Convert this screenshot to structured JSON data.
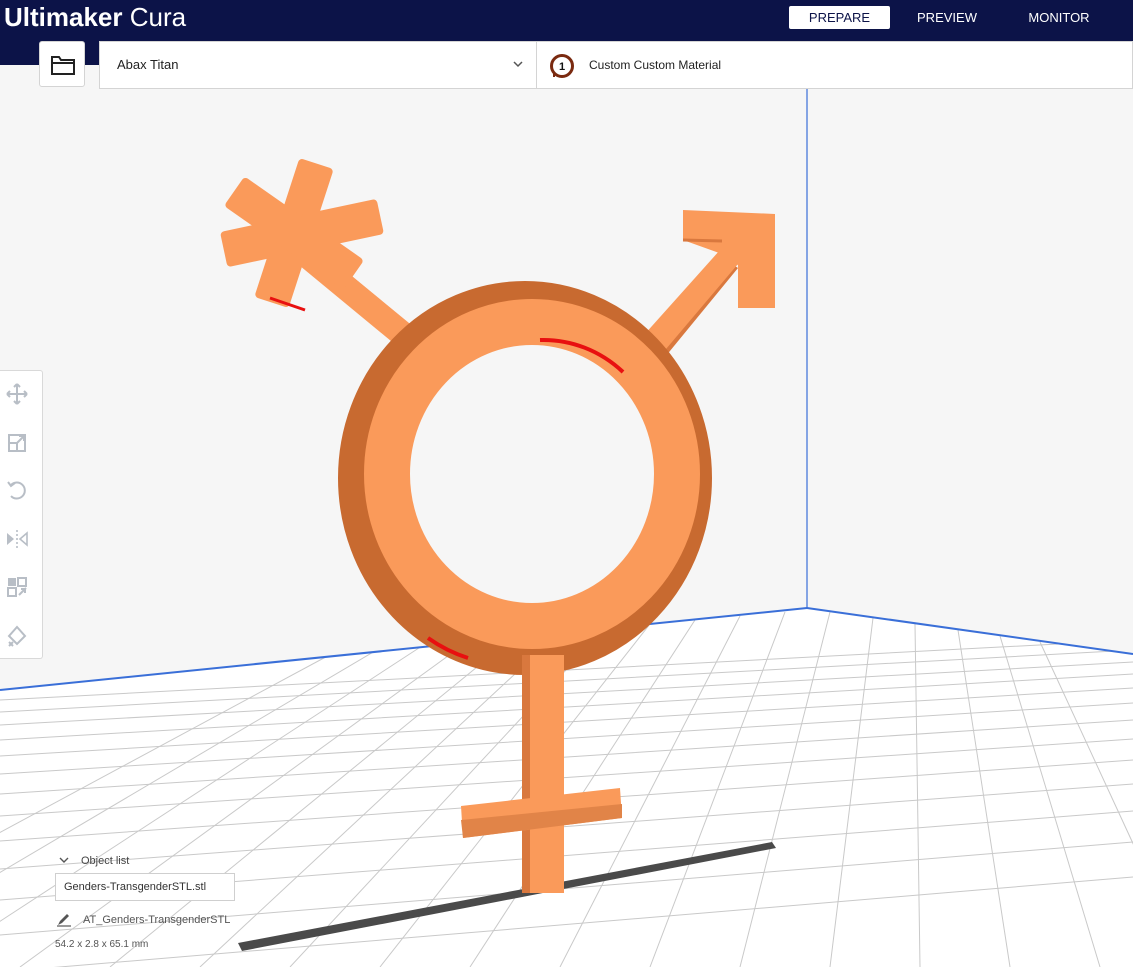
{
  "app": {
    "brand_bold": "Ultimaker",
    "brand_light": "Cura"
  },
  "stages": [
    {
      "label": "PREPARE",
      "active": true
    },
    {
      "label": "PREVIEW",
      "active": false
    },
    {
      "label": "MONITOR",
      "active": false
    }
  ],
  "printer": {
    "name": "Abax Titan"
  },
  "extruder": {
    "number": "1",
    "material": "Custom Custom Material"
  },
  "tools": [
    "move-icon",
    "scale-icon",
    "rotate-icon",
    "mirror-icon",
    "per-model-settings-icon",
    "support-blocker-icon"
  ],
  "object_list": {
    "title": "Object list",
    "file": "Genders-TransgenderSTL.stl",
    "job_name": "AT_Genders-TransgenderSTL",
    "dimensions": "54.2 x 2.8 x 65.1 mm"
  },
  "colors": {
    "header": "#0c1348",
    "model": "#fa9a5a",
    "model_shade": "#d9783e",
    "overhang": "#e81010",
    "build_plate": "#ffffff",
    "grid": "#c9c9c9"
  }
}
